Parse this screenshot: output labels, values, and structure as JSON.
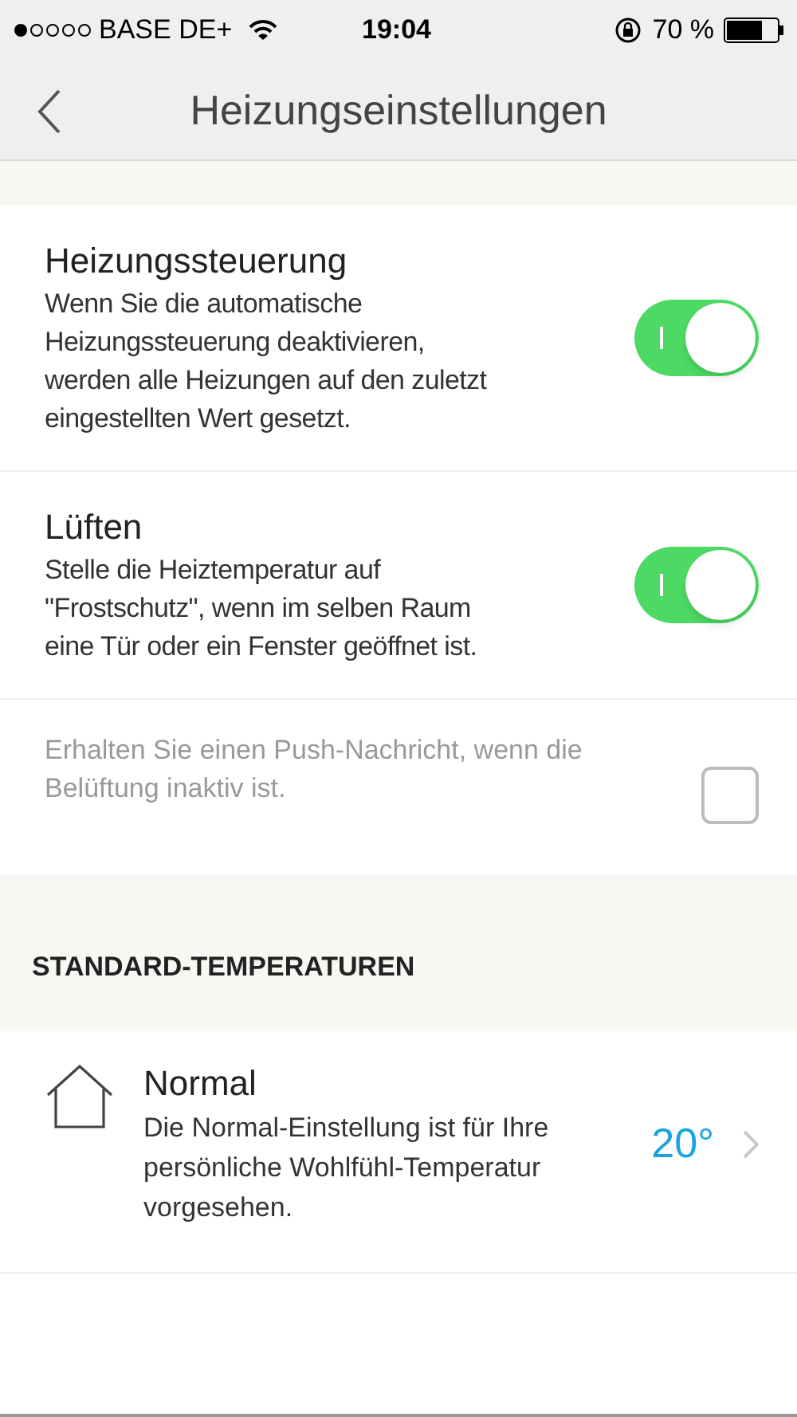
{
  "status_bar": {
    "carrier": "BASE DE+",
    "time": "19:04",
    "battery": "70 %"
  },
  "nav": {
    "title": "Heizungseinstellungen"
  },
  "settings": [
    {
      "kind": "toggle",
      "title": "Heizungssteuerung",
      "description": "Wenn Sie die automatische Heizungssteuerung deaktivieren, werden alle Heizungen auf den zuletzt eingestellten Wert gesetzt.",
      "on": true
    },
    {
      "kind": "toggle",
      "title": "Lüften",
      "description": "Stelle die Heiztemperatur auf \"Frostschutz\", wenn im selben Raum eine Tür oder ein Fenster geöffnet ist.",
      "on": true
    },
    {
      "kind": "checkbox",
      "description": "Erhalten Sie einen Push-Nachricht, wenn die Belüftung inaktiv ist.",
      "checked": false
    }
  ],
  "section_header": "STANDARD-TEMPERATUREN",
  "temperatures": [
    {
      "title": "Normal",
      "description": "Die Normal-Einstellung ist für Ihre persönliche Wohlfühl-Temperatur vorgesehen.",
      "value": "20°"
    }
  ]
}
